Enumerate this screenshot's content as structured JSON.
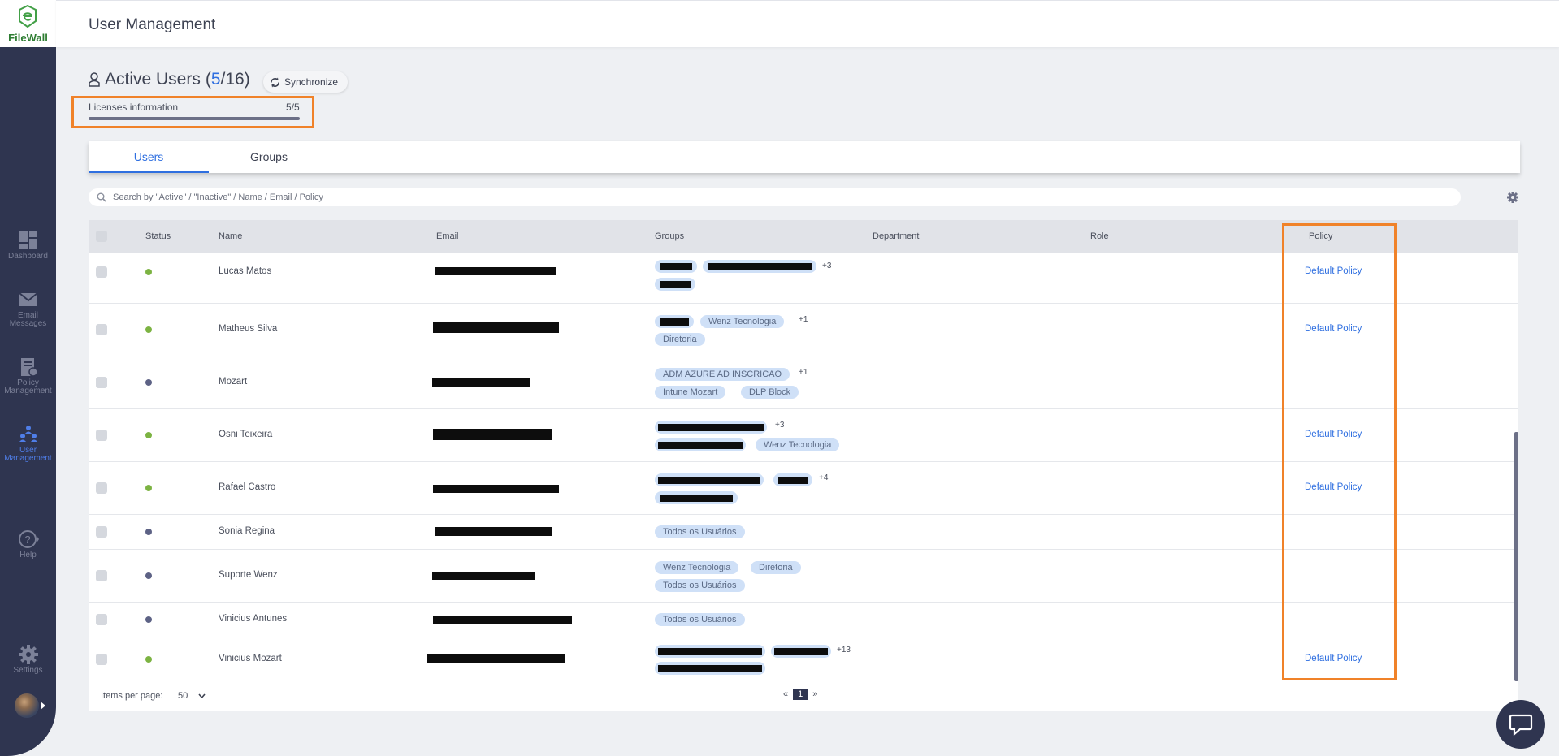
{
  "app": {
    "logo_text": "FileWall",
    "header_title": "User Management"
  },
  "sidebar": {
    "items": [
      {
        "label": "Dashboard",
        "icon": "dashboard-icon"
      },
      {
        "label": "Email Messages",
        "icon": "email-icon"
      },
      {
        "label": "Policy Management",
        "icon": "policy-icon"
      },
      {
        "label": "User Management",
        "icon": "users-icon",
        "active": true
      },
      {
        "label": "Help",
        "icon": "help-icon"
      },
      {
        "label": "Settings",
        "icon": "settings-icon"
      }
    ]
  },
  "active_users": {
    "title": "Active Users",
    "open": "(",
    "active": "5",
    "sep": "/16)",
    "sync_label": "Synchronize"
  },
  "licenses": {
    "label": "Licenses information",
    "value": "5/5",
    "fill_fraction": 1.0
  },
  "tabs": [
    {
      "label": "Users",
      "active": true
    },
    {
      "label": "Groups",
      "active": false
    }
  ],
  "search": {
    "placeholder": "Search by \"Active\" / \"Inactive\" / Name / Email / Policy"
  },
  "table": {
    "columns": [
      "Status",
      "Name",
      "Email",
      "Groups",
      "Department",
      "Role",
      "Policy"
    ],
    "rows": [
      {
        "name": "Lucas Matos",
        "status": "active",
        "policy": "Default Policy",
        "more": "+3"
      },
      {
        "name": "Matheus Silva",
        "status": "active",
        "policy": "Default Policy",
        "more": "+1",
        "chips": [
          "Wenz Tecnologia",
          "Diretoria"
        ]
      },
      {
        "name": "Mozart",
        "status": "inactive",
        "policy": "",
        "more": "+1",
        "chips": [
          "ADM AZURE AD INSCRICAO",
          "Intune Mozart",
          "DLP Block"
        ]
      },
      {
        "name": "Osni Teixeira",
        "status": "active",
        "policy": "Default Policy",
        "more": "+3",
        "chips": [
          "Wenz Tecnologia"
        ]
      },
      {
        "name": "Rafael Castro",
        "status": "active",
        "policy": "Default Policy",
        "more": "+4"
      },
      {
        "name": "Sonia Regina",
        "status": "inactive",
        "policy": "",
        "chips": [
          "Todos os Usuários"
        ]
      },
      {
        "name": "Suporte Wenz",
        "status": "inactive",
        "policy": "",
        "chips": [
          "Wenz Tecnologia",
          "Diretoria",
          "Todos os Usuários"
        ]
      },
      {
        "name": "Vinicius Antunes",
        "status": "inactive",
        "policy": "",
        "chips": [
          "Todos os Usuários"
        ]
      },
      {
        "name": "Vinicius Mozart",
        "status": "active",
        "policy": "Default Policy",
        "more": "+13"
      }
    ]
  },
  "footer": {
    "items_per_page_label": "Items per page:",
    "items_per_page": "50",
    "prev": "«",
    "page": "1",
    "next": "»"
  },
  "colors": {
    "accent": "#2f6fe0",
    "sidebar": "#2f3550",
    "highlight": "#f08229",
    "active_dot": "#7cb342",
    "inactive_dot": "#5d6285"
  }
}
